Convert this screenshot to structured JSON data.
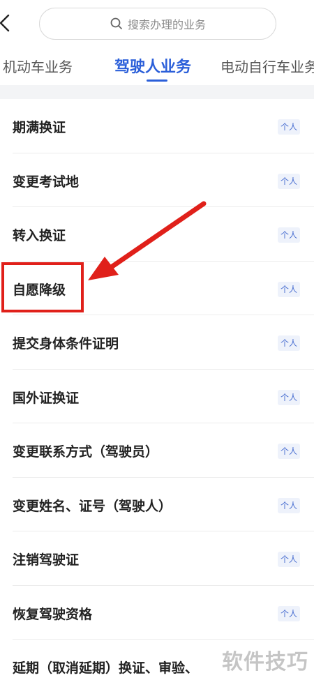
{
  "search": {
    "placeholder_text": "搜索办理的业务"
  },
  "tabs": [
    {
      "label": "机动车业务",
      "active": false
    },
    {
      "label": "驾驶人业务",
      "active": true
    },
    {
      "label": "电动自行车业务",
      "active": false
    }
  ],
  "items": [
    {
      "label": "期满换证",
      "tag": "个人"
    },
    {
      "label": "变更考试地",
      "tag": "个人"
    },
    {
      "label": "转入换证",
      "tag": "个人"
    },
    {
      "label": "自愿降级",
      "tag": "个人"
    },
    {
      "label": "提交身体条件证明",
      "tag": "个人"
    },
    {
      "label": "国外证换证",
      "tag": "个人"
    },
    {
      "label": "变更联系方式（驾驶员）",
      "tag": "个人"
    },
    {
      "label": "变更姓名、证号（驾驶人）",
      "tag": "个人"
    },
    {
      "label": "注销驾驶证",
      "tag": "个人"
    },
    {
      "label": "恢复驾驶资格",
      "tag": "个人"
    },
    {
      "label": "延期（取消延期）换证、审验、",
      "tag": ""
    }
  ],
  "watermark": {
    "text": "软件技巧"
  },
  "colors": {
    "accent": "#2b5fd9",
    "annotation": "#e0201a",
    "tag_bg": "#eef2fb"
  }
}
